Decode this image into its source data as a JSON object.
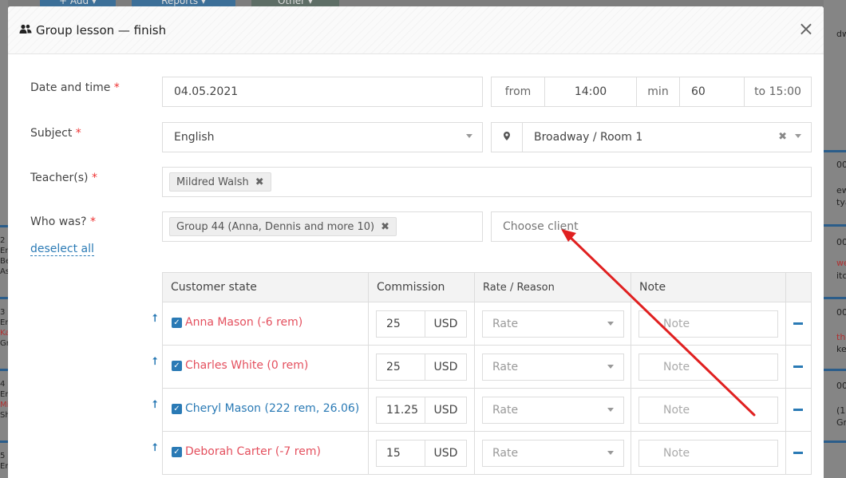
{
  "background": {
    "toolbar_buttons": [
      "+ Add ▾",
      "Reports ▾",
      "Other ▾"
    ],
    "right_fragments": [
      "dw",
      "00",
      "ew",
      "tya",
      "00",
      "we",
      "itc",
      "00",
      "the",
      "ke",
      "00",
      "(1",
      "Gr"
    ],
    "left_fragments": [
      "2",
      "Er",
      "Be",
      "As",
      "3",
      "Er",
      "Ka",
      "Gr",
      "4",
      "Er",
      "Mi",
      "Sh",
      "5",
      "Er"
    ]
  },
  "modal": {
    "title": "Group lesson — finish",
    "title_icon": "users-icon",
    "close_label": "×"
  },
  "form": {
    "date_label": "Date and time",
    "date_value": "04.05.2021",
    "from_label": "from",
    "time_from": "14:00",
    "min_label": "min",
    "minutes": "60",
    "to_label": "to 15:00",
    "subject_label": "Subject",
    "subject_value": "English",
    "location_value": "Broadway / Room 1",
    "teachers_label": "Teacher(s)",
    "teacher_tag": "Mildred Walsh",
    "who_label": "Who was?",
    "deselect_all": "deselect all",
    "group_tag": "Group 44 (Anna, Dennis and more 10)",
    "choose_client_placeholder": "Choose client",
    "required_mark": "*"
  },
  "table": {
    "headers": [
      "Customer state",
      "Commission",
      "Rate / Reason",
      "Note"
    ],
    "rows": [
      {
        "name": "Anna Mason (-6 rem)",
        "color": "#e4505e",
        "commission": "25",
        "currency": "USD",
        "rate": "Rate",
        "note": "Note"
      },
      {
        "name": "Charles White (0 rem)",
        "color": "#e4505e",
        "commission": "25",
        "currency": "USD",
        "rate": "Rate",
        "note": "Note"
      },
      {
        "name": "Cheryl Mason (222 rem, 26.06)",
        "color": "#2a7ab5",
        "commission": "11.25",
        "currency": "USD",
        "rate": "Rate",
        "note": "Note"
      },
      {
        "name": "Deborah Carter (-7 rem)",
        "color": "#e4505e",
        "commission": "15",
        "currency": "USD",
        "rate": "Rate",
        "note": "Note"
      }
    ]
  },
  "colors": {
    "accent": "#2a7ab5",
    "negative": "#e4505e",
    "annotation_arrow": "#e02020"
  }
}
